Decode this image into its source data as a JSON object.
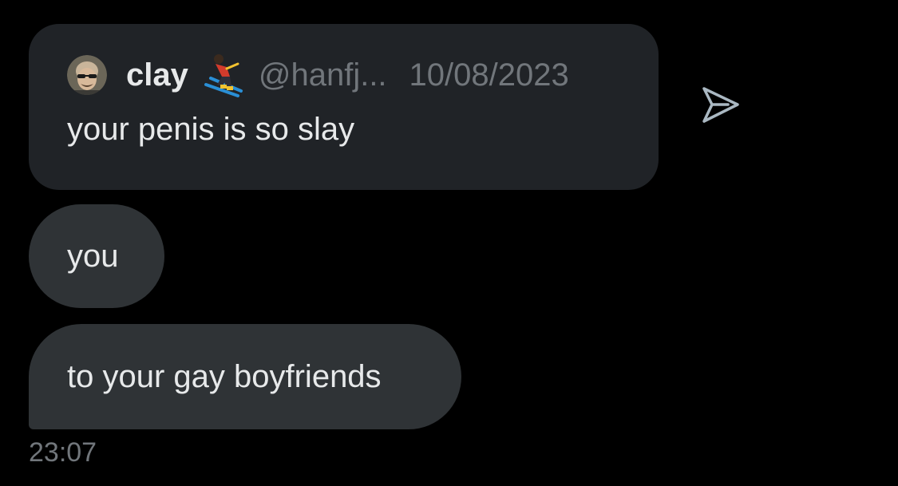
{
  "quoted_message": {
    "author_name": "clay",
    "author_badge_icon": "skier-emoji-icon",
    "handle": "@hanfj...",
    "date": "10/08/2023",
    "text": "your penis is so slay"
  },
  "share_icon": "send-arrow-icon",
  "messages": [
    {
      "text": "you"
    },
    {
      "text": "to your gay boyfriends"
    }
  ],
  "timestamp": "23:07",
  "colors": {
    "background": "#000000",
    "quote_card": "#202327",
    "bubble": "#2f3336",
    "primary_text": "#e7e9ea",
    "secondary_text": "#71767b",
    "share_icon": "#aab8c2"
  }
}
